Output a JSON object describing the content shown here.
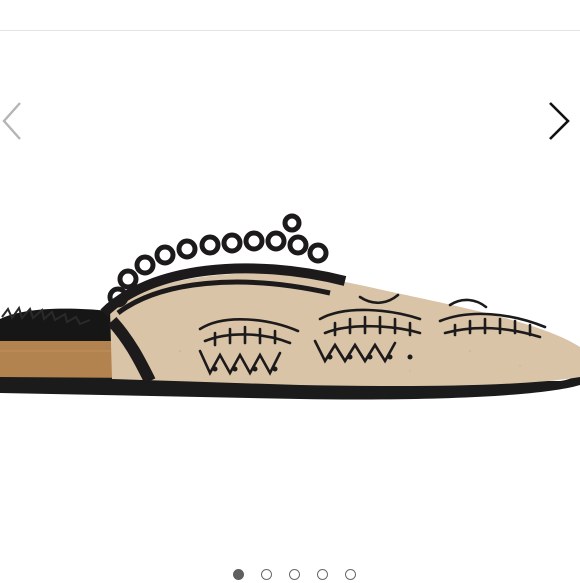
{
  "carousel": {
    "prev_icon": "chevron-left-icon",
    "next_icon": "chevron-right-icon",
    "image_subject": "product-photo",
    "slide_count": 5,
    "active_slide": 1
  },
  "colors": {
    "felt": "#d9c4a8",
    "embroidery": "#1c1a1a",
    "cork": "#b3834f",
    "fur": "#161616",
    "chevron_next": "#111111",
    "chevron_prev": "#b5b5b5"
  }
}
